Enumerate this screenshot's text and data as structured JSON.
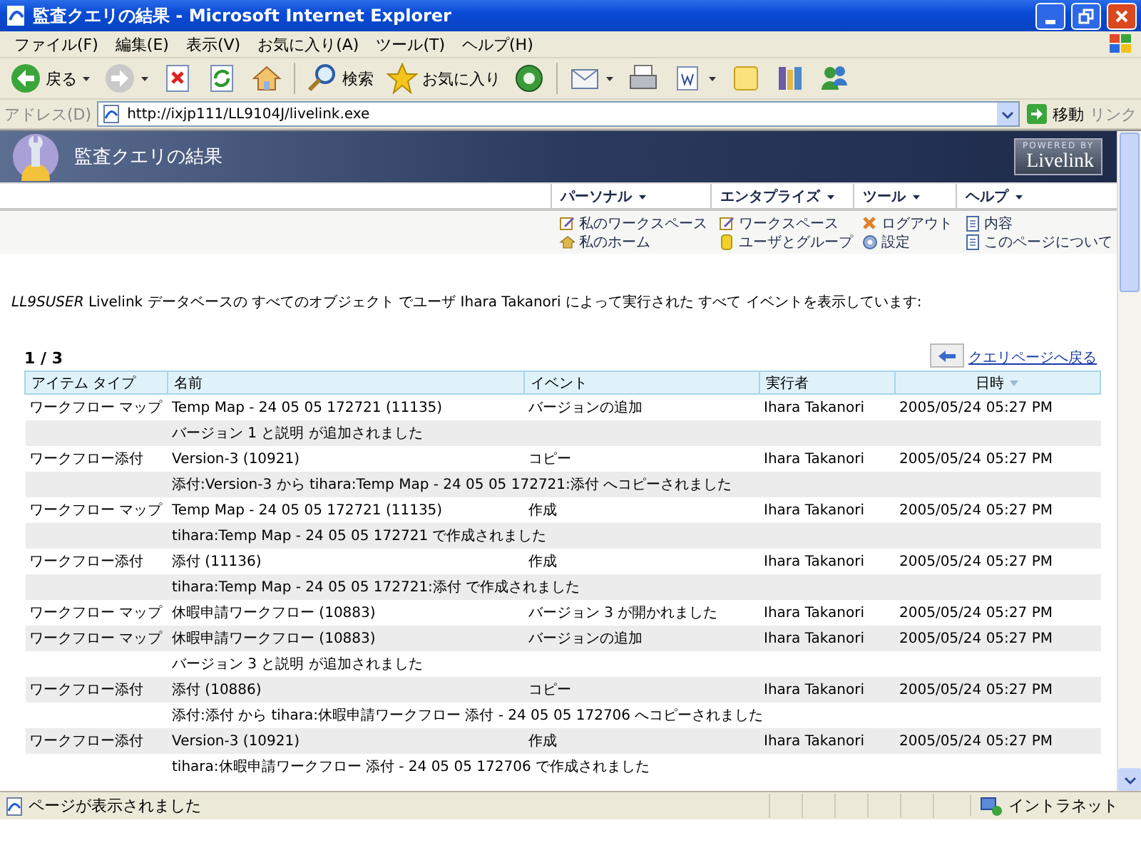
{
  "window": {
    "title": "監査クエリの結果 - Microsoft Internet Explorer"
  },
  "menu": [
    "ファイル(F)",
    "編集(E)",
    "表示(V)",
    "お気に入り(A)",
    "ツール(T)",
    "ヘルプ(H)"
  ],
  "toolbar": [
    {
      "kind": "back",
      "label": "戻る",
      "dropdown": true
    },
    {
      "kind": "forward",
      "dropdown": true
    },
    {
      "kind": "stop"
    },
    {
      "kind": "refresh"
    },
    {
      "kind": "home"
    },
    {
      "kind": "search",
      "label": "検索"
    },
    {
      "kind": "favorites",
      "label": "お気に入り"
    },
    {
      "kind": "media"
    },
    {
      "kind": "mail",
      "dropdown": true
    },
    {
      "kind": "print"
    },
    {
      "kind": "edit",
      "dropdown": true
    },
    {
      "kind": "folder"
    },
    {
      "kind": "research"
    },
    {
      "kind": "messenger"
    }
  ],
  "address_bar": {
    "label": "アドレス(D)",
    "value": "http://ixjp111/LL9104J/livelink.exe",
    "go": "移動",
    "links": "リンク"
  },
  "page_header": {
    "title": "監査クエリの結果",
    "logo_small": "POWERED BY",
    "logo": "Livelink"
  },
  "nav_menus": [
    {
      "label": "パーソナル",
      "items": [
        {
          "kind": "edit",
          "label": "私のワークスペース"
        },
        {
          "kind": "home",
          "label": "私のホーム"
        }
      ]
    },
    {
      "label": "エンタプライズ",
      "items": [
        {
          "kind": "edit",
          "label": "ワークスペース"
        },
        {
          "kind": "users",
          "label": "ユーザとグループ"
        }
      ]
    },
    {
      "label": "ツール",
      "items": [
        {
          "kind": "logout",
          "label": "ログアウト"
        },
        {
          "kind": "settings",
          "label": "設定"
        }
      ]
    },
    {
      "label": "ヘルプ",
      "items": [
        {
          "kind": "page",
          "label": "内容"
        },
        {
          "kind": "page",
          "label": "このページについて"
        }
      ]
    }
  ],
  "message": "*LL9SUSER* Livelink データベースの すべてのオブジェクト でユーザ Ihara Takanori によって実行された すべて イベントを表示しています:",
  "pager": "1 / 3",
  "back_link": "クエリページへ戻る",
  "table": {
    "columns": [
      {
        "label": "アイテム タイプ",
        "sorted": false
      },
      {
        "label": "名前",
        "sorted": false
      },
      {
        "label": "イベント",
        "sorted": false
      },
      {
        "label": "実行者",
        "sorted": false
      },
      {
        "label": "日時",
        "sorted": true
      }
    ],
    "rows": [
      {
        "type": "ワークフロー マップ",
        "name": "Temp Map - 24 05 05 172721 (11135)",
        "event": "バージョンの追加",
        "actor": "Ihara Takanori",
        "date": "2005/05/24 05:27 PM",
        "detail": "バージョン 1 と説明 が追加されました"
      },
      {
        "type": "ワークフロー添付",
        "name": "Version-3 (10921)",
        "event": "コピー",
        "actor": "Ihara Takanori",
        "date": "2005/05/24 05:27 PM",
        "detail": "添付:Version-3 から tihara:Temp Map - 24 05 05 172721:添付 へコピーされました"
      },
      {
        "type": "ワークフロー マップ",
        "name": "Temp Map - 24 05 05 172721 (11135)",
        "event": "作成",
        "actor": "Ihara Takanori",
        "date": "2005/05/24 05:27 PM",
        "detail": "tihara:Temp Map - 24 05 05 172721 で作成されました"
      },
      {
        "type": "ワークフロー添付",
        "name": "添付 (11136)",
        "event": "作成",
        "actor": "Ihara Takanori",
        "date": "2005/05/24 05:27 PM",
        "detail": "tihara:Temp Map - 24 05 05 172721:添付 で作成されました"
      },
      {
        "type": "ワークフロー マップ",
        "name": "休暇申請ワークフロー (10883)",
        "event": "バージョン 3 が開かれました",
        "actor": "Ihara Takanori",
        "date": "2005/05/24 05:27 PM"
      },
      {
        "type": "ワークフロー マップ",
        "name": "休暇申請ワークフロー (10883)",
        "event": "バージョンの追加",
        "actor": "Ihara Takanori",
        "date": "2005/05/24 05:27 PM",
        "detail": "バージョン 3 と説明 が追加されました"
      },
      {
        "type": "ワークフロー添付",
        "name": "添付 (10886)",
        "event": "コピー",
        "actor": "Ihara Takanori",
        "date": "2005/05/24 05:27 PM",
        "detail": "添付:添付 から tihara:休暇申請ワークフロー 添付 - 24 05 05 172706 へコピーされました"
      },
      {
        "type": "ワークフロー添付",
        "name": "Version-3 (10921)",
        "event": "作成",
        "actor": "Ihara Takanori",
        "date": "2005/05/24 05:27 PM",
        "detail": "tihara:休暇申請ワークフロー 添付 - 24 05 05 172706 で作成されました"
      }
    ]
  },
  "status_bar": {
    "text": "ページが表示されました",
    "zone": "イントラネット"
  }
}
